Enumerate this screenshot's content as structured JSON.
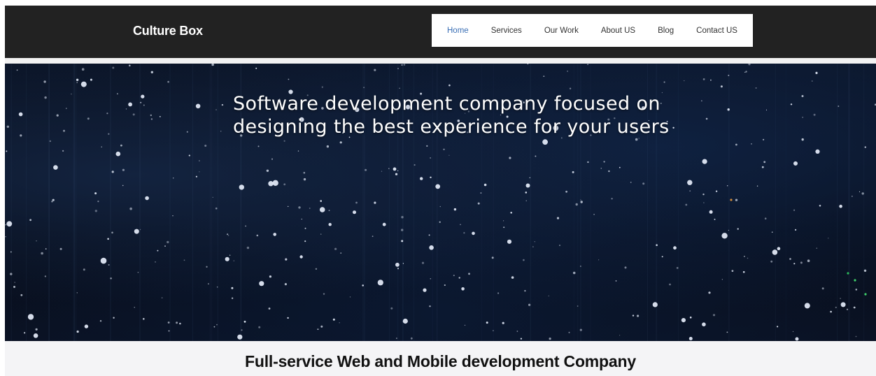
{
  "header": {
    "brand": "Culture Box",
    "nav": [
      {
        "label": "Home",
        "active": true
      },
      {
        "label": "Services",
        "active": false
      },
      {
        "label": "Our Work",
        "active": false
      },
      {
        "label": "About US",
        "active": false
      },
      {
        "label": "Blog",
        "active": false
      },
      {
        "label": "Contact US",
        "active": false
      }
    ]
  },
  "hero": {
    "title": "Software development company focused on designing the best experience for your users"
  },
  "section": {
    "heading": "Full-service Web and Mobile development Company"
  },
  "colors": {
    "navbar_bg": "#222222",
    "active_link": "#3a6fb5",
    "hero_bg": "#0b1426"
  }
}
